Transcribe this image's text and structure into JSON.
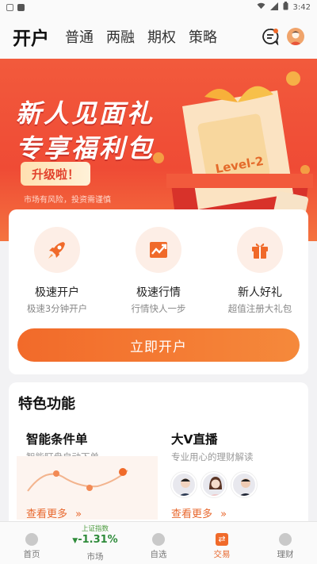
{
  "status_bar": {
    "time": "3:42"
  },
  "nav": {
    "tabs": [
      {
        "label": "开户",
        "active": true
      },
      {
        "label": "普通"
      },
      {
        "label": "两融"
      },
      {
        "label": "期权"
      },
      {
        "label": "策略"
      }
    ],
    "icons": [
      "message-icon",
      "avatar"
    ]
  },
  "banner": {
    "title_line1": "新人见面礼",
    "title_line2": "专享福利包",
    "button": "升级啦！",
    "note": "市场有风险，投资需谨慎",
    "ticket_text": "Level-2"
  },
  "open_account": {
    "features": [
      {
        "title": "极速开户",
        "subtitle": "极速3分钟开户",
        "icon": "rocket-icon"
      },
      {
        "title": "极速行情",
        "subtitle": "行情快人一步",
        "icon": "trend-chart-icon"
      },
      {
        "title": "新人好礼",
        "subtitle": "超值注册大礼包",
        "icon": "gift-icon"
      }
    ],
    "button": "立即开户"
  },
  "special": {
    "heading": "特色功能",
    "items": [
      {
        "title": "智能条件单",
        "subtitle": "智能盯盘自动下单",
        "more": "查看更多"
      },
      {
        "title": "大V直播",
        "subtitle": "专业用心的理财解读",
        "more": "查看更多"
      }
    ]
  },
  "tabbar": {
    "items": [
      {
        "label": "首页"
      },
      {
        "label": "市场",
        "index_name": "上证指数",
        "index_value": "-1.31%"
      },
      {
        "label": "自选"
      },
      {
        "label": "交易",
        "active": true
      },
      {
        "label": "理财"
      }
    ]
  },
  "colors": {
    "accent": "#F26A2A",
    "banner_red": "#EF4B35",
    "down_green": "#2E8B3A"
  }
}
